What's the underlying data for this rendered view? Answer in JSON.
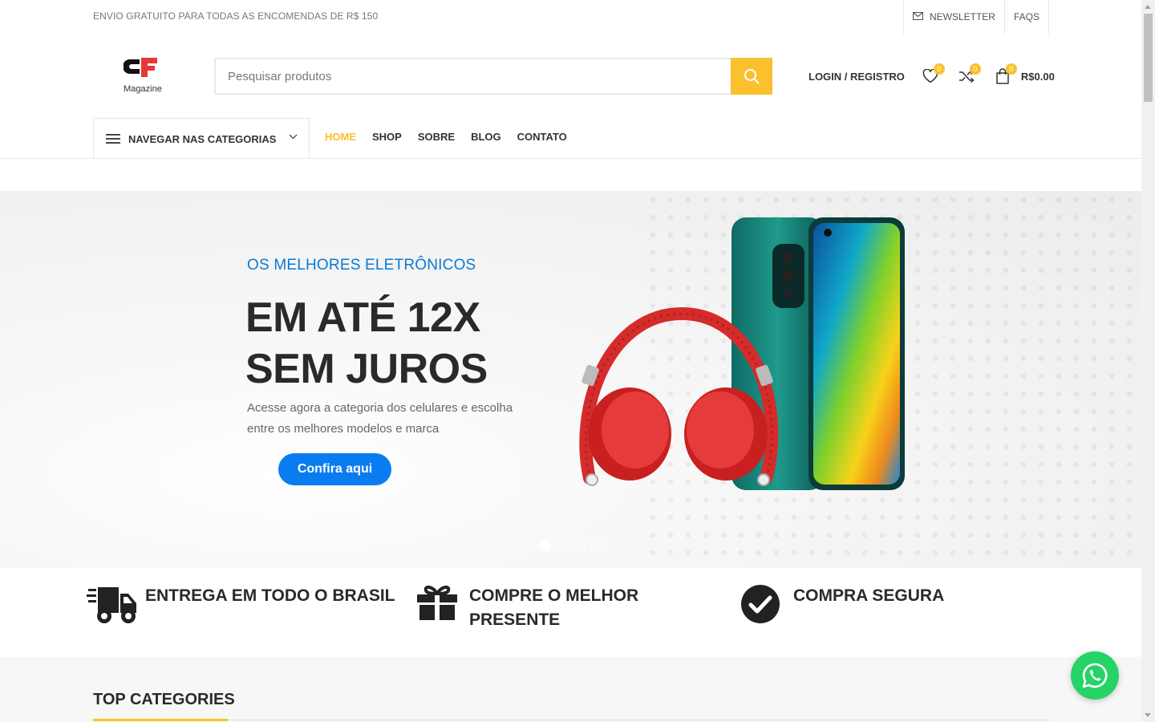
{
  "topbar": {
    "promo": "ENVIO GRATUITO PARA TODAS AS ENCOMENDAS DE R$ 150",
    "newsletter": "NEWSLETTER",
    "faqs": "FAQS"
  },
  "header": {
    "logo_text": "Magazine",
    "search_placeholder": "Pesquisar produtos",
    "login": "LOGIN / REGISTRO",
    "wishlist_count": "0",
    "compare_count": "0",
    "cart_count": "0",
    "cart_total": "R$0.00"
  },
  "nav": {
    "categories_label": "NAVEGAR NAS CATEGORIAS",
    "items": [
      "HOME",
      "SHOP",
      "SOBRE",
      "BLOG",
      "CONTATO"
    ]
  },
  "hero": {
    "subtitle": "OS MELHORES ELETRÔNICOS",
    "title_line1": "EM ATÉ 12X",
    "title_line2": "SEM JUROS",
    "description": "Acesse agora a categoria dos celulares e escolha entre os melhores modelos e marca",
    "cta": "Confira aqui",
    "slides": 4,
    "active_slide": 1
  },
  "features": [
    {
      "title": "ENTREGA EM TODO O BRASIL",
      "icon": "truck-icon"
    },
    {
      "title": "COMPRE O MELHOR PRESENTE",
      "icon": "gift-icon"
    },
    {
      "title": "COMPRA SEGURA",
      "icon": "check-circle-icon"
    }
  ],
  "section": {
    "top_categories": "TOP CATEGORIES"
  },
  "colors": {
    "accent": "#fbc02d",
    "hero_subtitle": "#0a7ad6",
    "cta": "#0a7cf0",
    "whatsapp": "#25d366"
  }
}
